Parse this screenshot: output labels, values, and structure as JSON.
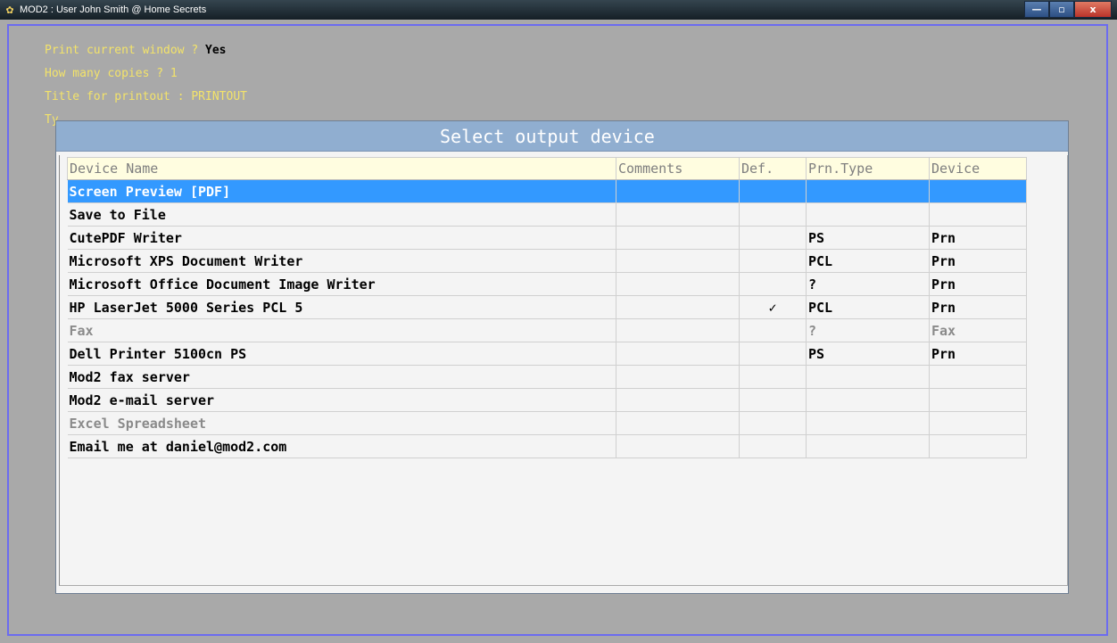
{
  "window": {
    "title": "MOD2 : User John Smith @ Home Secrets",
    "controls": {
      "minimize": "—",
      "maximize": "▫",
      "close": "x"
    }
  },
  "prompts": [
    {
      "label": "Print current window ? ",
      "answer": "Yes"
    },
    {
      "label": "How many copies ? 1",
      "answer": ""
    },
    {
      "label": "Title for printout : PRINTOUT",
      "answer": ""
    },
    {
      "label": "Ty",
      "answer": ""
    }
  ],
  "dialog": {
    "title": "Select output device",
    "columns": [
      "Device Name",
      "Comments",
      "Def.",
      "Prn.Type",
      "Device"
    ],
    "rows": [
      {
        "name": "Screen Preview [PDF]",
        "comments": "",
        "def": "",
        "prn_type": "",
        "device": "",
        "selected": true,
        "disabled": false
      },
      {
        "name": "Save to File",
        "comments": "",
        "def": "",
        "prn_type": "",
        "device": "",
        "selected": false,
        "disabled": false
      },
      {
        "name": "CutePDF Writer",
        "comments": "",
        "def": "",
        "prn_type": "PS",
        "device": "Prn",
        "selected": false,
        "disabled": false
      },
      {
        "name": "Microsoft XPS Document Writer",
        "comments": "",
        "def": "",
        "prn_type": "PCL",
        "device": "Prn",
        "selected": false,
        "disabled": false
      },
      {
        "name": "Microsoft Office Document Image Writer",
        "comments": "",
        "def": "",
        "prn_type": "?",
        "device": "Prn",
        "selected": false,
        "disabled": false
      },
      {
        "name": "HP LaserJet 5000 Series PCL 5",
        "comments": "",
        "def": "✓",
        "prn_type": "PCL",
        "device": "Prn",
        "selected": false,
        "disabled": false
      },
      {
        "name": "Fax",
        "comments": "",
        "def": "",
        "prn_type": "?",
        "device": "Fax",
        "selected": false,
        "disabled": true
      },
      {
        "name": "Dell Printer 5100cn PS",
        "comments": "",
        "def": "",
        "prn_type": "PS",
        "device": "Prn",
        "selected": false,
        "disabled": false
      },
      {
        "name": "Mod2 fax server",
        "comments": "",
        "def": "",
        "prn_type": "",
        "device": "",
        "selected": false,
        "disabled": false
      },
      {
        "name": "Mod2 e-mail server",
        "comments": "",
        "def": "",
        "prn_type": "",
        "device": "",
        "selected": false,
        "disabled": false
      },
      {
        "name": "Excel Spreadsheet",
        "comments": "",
        "def": "",
        "prn_type": "",
        "device": "",
        "selected": false,
        "disabled": true
      },
      {
        "name": "Email me at daniel@mod2.com",
        "comments": "",
        "def": "",
        "prn_type": "",
        "device": "",
        "selected": false,
        "disabled": false
      }
    ]
  },
  "colors": {
    "prompt_text": "#f3e36a",
    "selection": "#3399ff",
    "dialog_header": "#90aed0",
    "check": "#cc2222"
  }
}
